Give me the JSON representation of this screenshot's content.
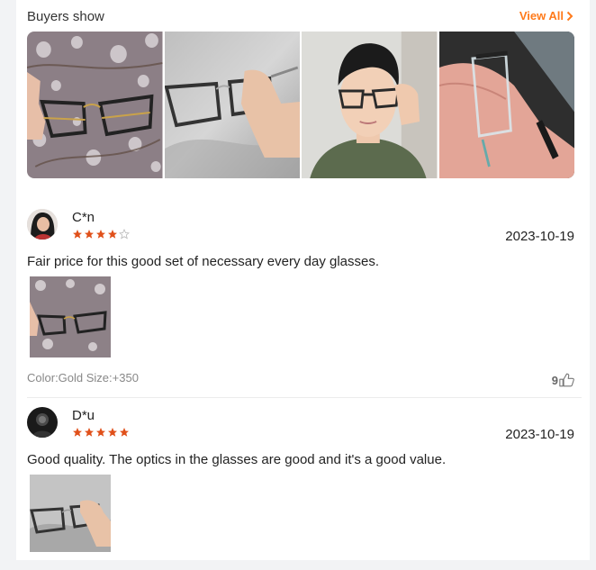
{
  "buyers_show": {
    "title": "Buyers show",
    "view_all_label": "View All"
  },
  "reviews": [
    {
      "reviewer": "C*n",
      "rating": 4,
      "date": "2023-10-19",
      "text": "Fair price for this good set of necessary every day glasses.",
      "sku": "Color:Gold Size:+350",
      "helpful_count": "9"
    },
    {
      "reviewer": "D*u",
      "rating": 5,
      "date": "2023-10-19",
      "text": "Good quality. The optics in the glasses are good and it's a good value."
    }
  ],
  "colors": {
    "accent": "#ff7a1a",
    "star": "#e0501a",
    "star_empty": "#c8c8c8"
  }
}
